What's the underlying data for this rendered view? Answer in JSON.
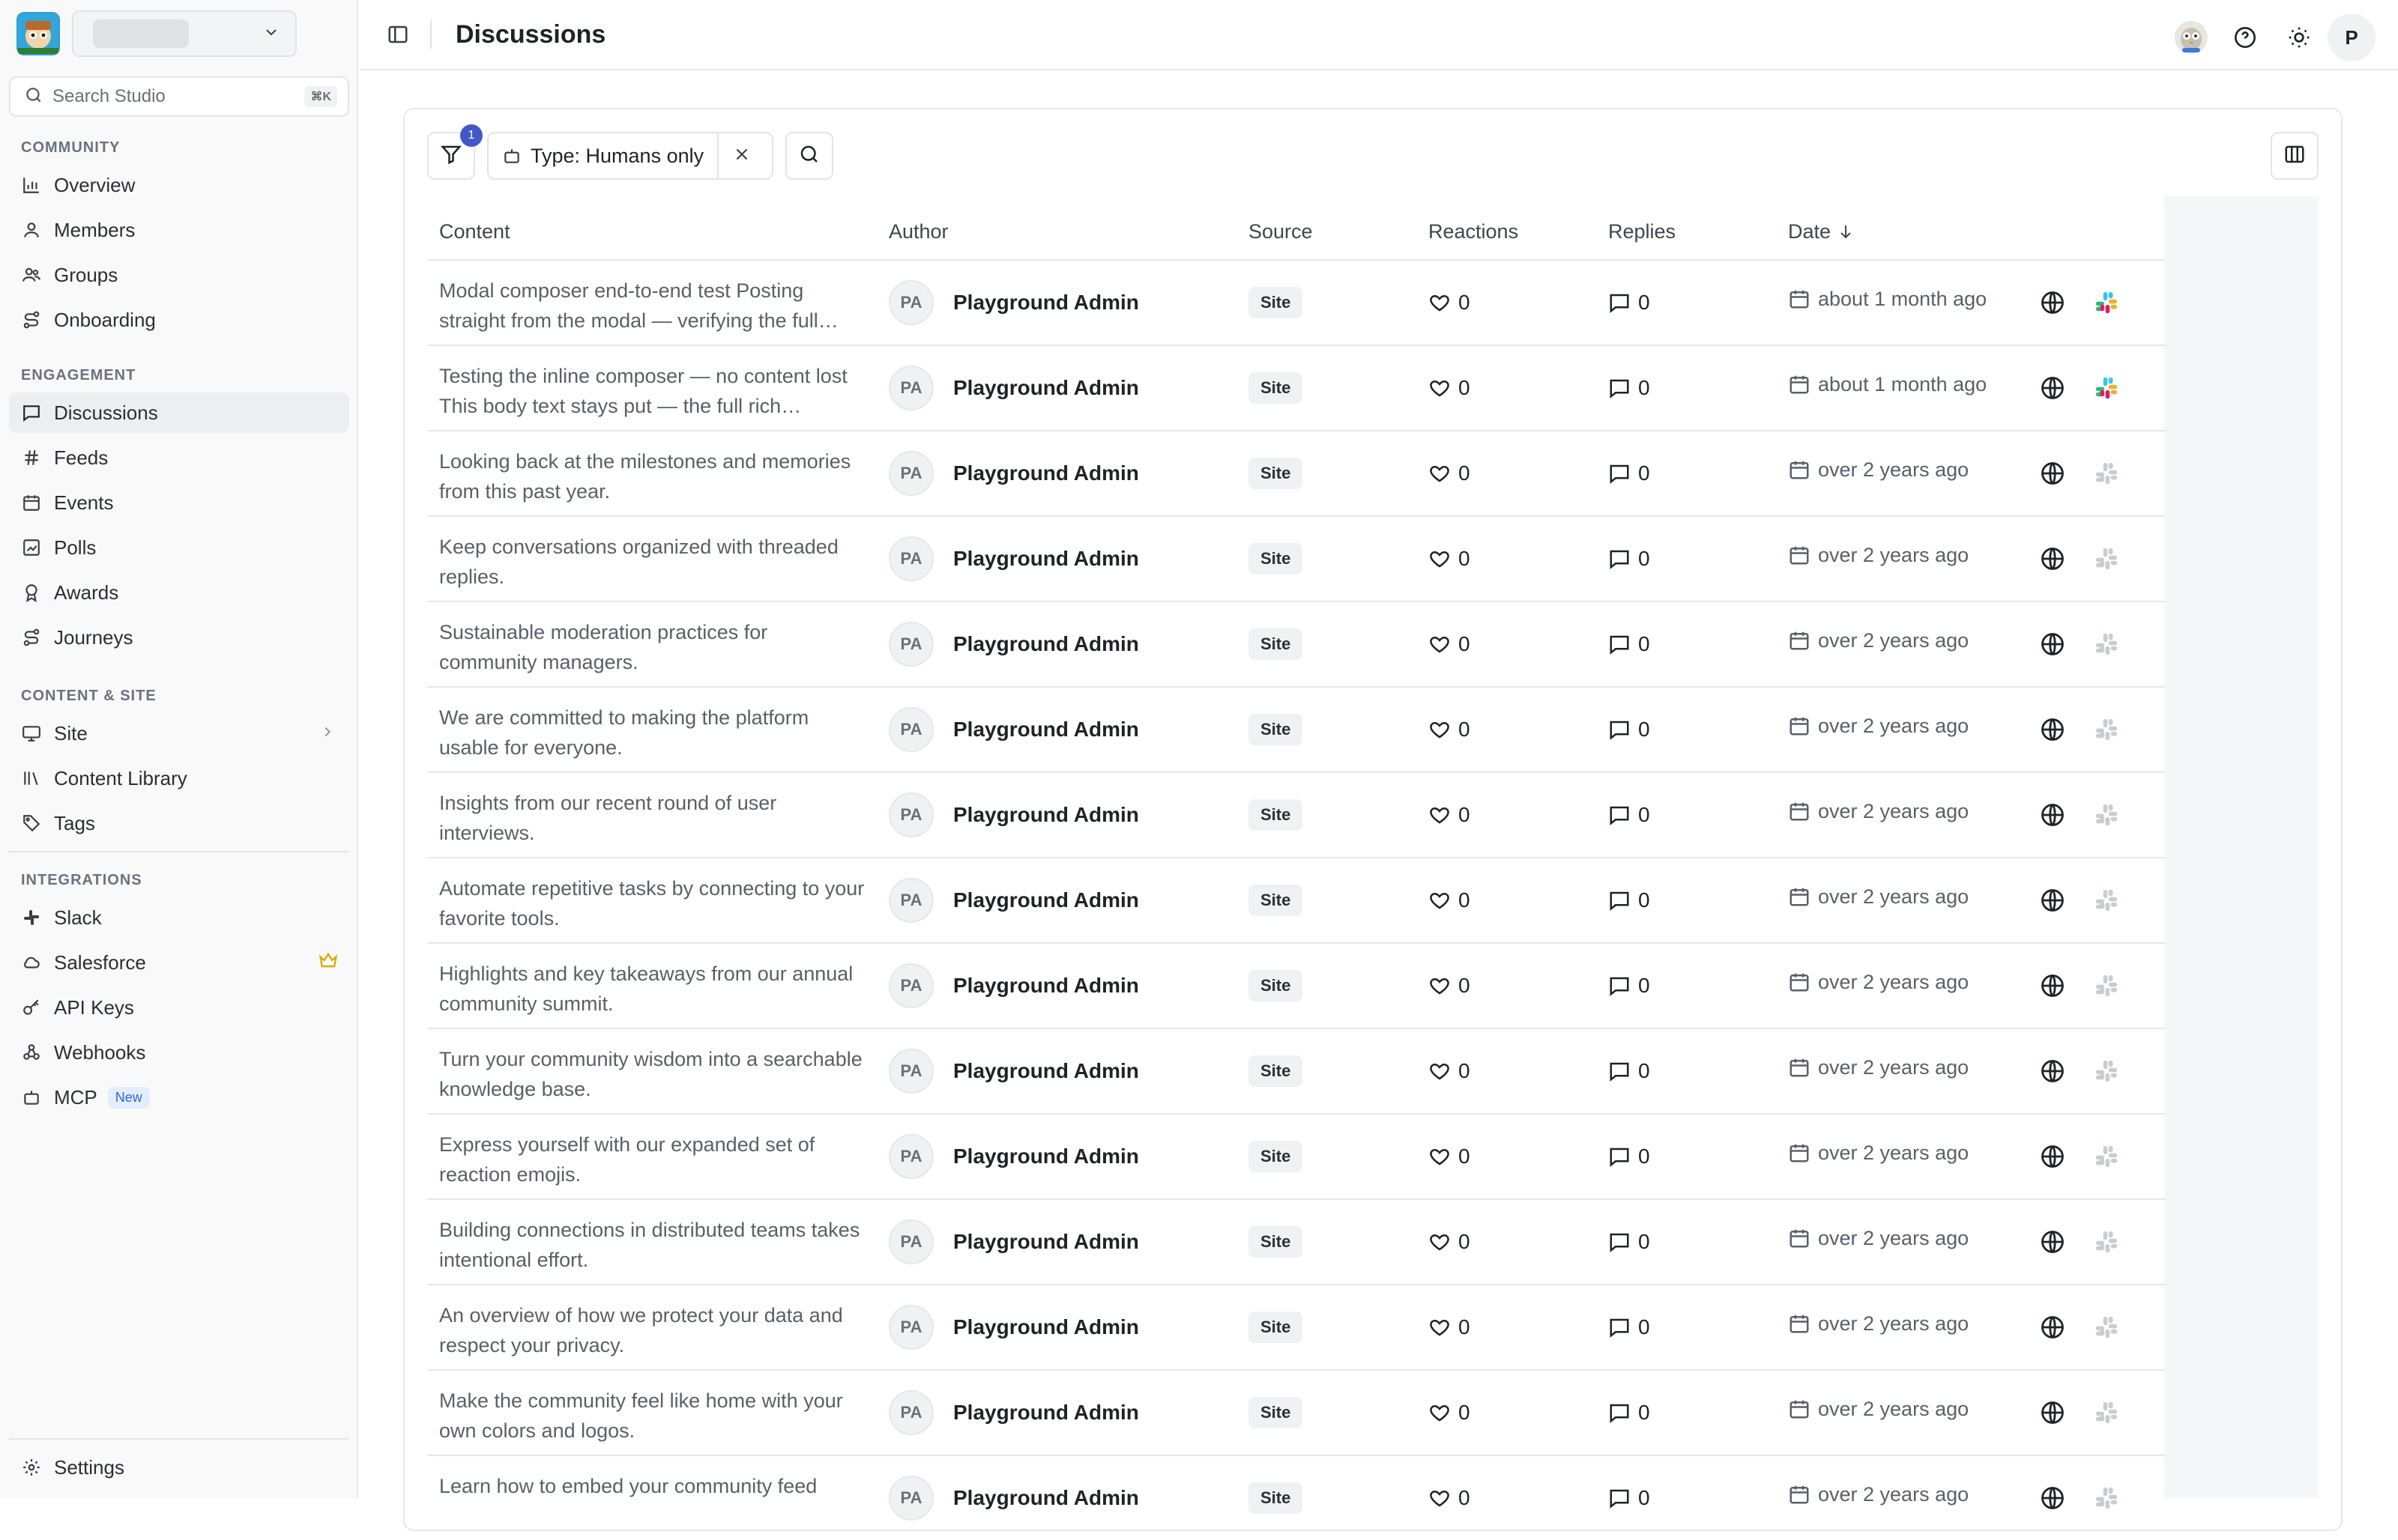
{
  "sidebar": {
    "search_placeholder": "Search Studio",
    "search_shortcut": "⌘K",
    "sections": {
      "community": "COMMUNITY",
      "engagement": "ENGAGEMENT",
      "content": "CONTENT & SITE",
      "integrations": "INTEGRATIONS"
    },
    "items": {
      "overview": "Overview",
      "members": "Members",
      "groups": "Groups",
      "onboarding": "Onboarding",
      "discussions": "Discussions",
      "feeds": "Feeds",
      "events": "Events",
      "polls": "Polls",
      "awards": "Awards",
      "journeys": "Journeys",
      "site": "Site",
      "content_library": "Content Library",
      "tags": "Tags",
      "slack": "Slack",
      "salesforce": "Salesforce",
      "api_keys": "API Keys",
      "webhooks": "Webhooks",
      "mcp": "MCP",
      "mcp_badge": "New",
      "settings": "Settings"
    }
  },
  "header": {
    "title": "Discussions",
    "avatar_initial": "P"
  },
  "toolbar": {
    "filter_count": "1",
    "filter_chip": "Type: Humans only"
  },
  "table": {
    "columns": [
      "Content",
      "Author",
      "Source",
      "Reactions",
      "Replies",
      "Date"
    ],
    "rows": [
      {
        "content": "Modal composer end-to-end test Posting straight from the modal — verifying the full…",
        "initials": "PA",
        "author": "Playground Admin",
        "source": "Site",
        "reactions": "0",
        "replies": "0",
        "date": "about 1 month ago",
        "slack": true
      },
      {
        "content": "Testing the inline composer — no content lost This body text stays put — the full rich…",
        "initials": "PA",
        "author": "Playground Admin",
        "source": "Site",
        "reactions": "0",
        "replies": "0",
        "date": "about 1 month ago",
        "slack": true
      },
      {
        "content": "Looking back at the milestones and memories from this past year.",
        "initials": "PA",
        "author": "Playground Admin",
        "source": "Site",
        "reactions": "0",
        "replies": "0",
        "date": "over 2 years ago",
        "slack": false
      },
      {
        "content": "Keep conversations organized with threaded replies.",
        "initials": "PA",
        "author": "Playground Admin",
        "source": "Site",
        "reactions": "0",
        "replies": "0",
        "date": "over 2 years ago",
        "slack": false
      },
      {
        "content": "Sustainable moderation practices for community managers.",
        "initials": "PA",
        "author": "Playground Admin",
        "source": "Site",
        "reactions": "0",
        "replies": "0",
        "date": "over 2 years ago",
        "slack": false
      },
      {
        "content": "We are committed to making the platform usable for everyone.",
        "initials": "PA",
        "author": "Playground Admin",
        "source": "Site",
        "reactions": "0",
        "replies": "0",
        "date": "over 2 years ago",
        "slack": false
      },
      {
        "content": "Insights from our recent round of user interviews.",
        "initials": "PA",
        "author": "Playground Admin",
        "source": "Site",
        "reactions": "0",
        "replies": "0",
        "date": "over 2 years ago",
        "slack": false
      },
      {
        "content": "Automate repetitive tasks by connecting to your favorite tools.",
        "initials": "PA",
        "author": "Playground Admin",
        "source": "Site",
        "reactions": "0",
        "replies": "0",
        "date": "over 2 years ago",
        "slack": false
      },
      {
        "content": "Highlights and key takeaways from our annual community summit.",
        "initials": "PA",
        "author": "Playground Admin",
        "source": "Site",
        "reactions": "0",
        "replies": "0",
        "date": "over 2 years ago",
        "slack": false
      },
      {
        "content": "Turn your community wisdom into a searchable knowledge base.",
        "initials": "PA",
        "author": "Playground Admin",
        "source": "Site",
        "reactions": "0",
        "replies": "0",
        "date": "over 2 years ago",
        "slack": false
      },
      {
        "content": "Express yourself with our expanded set of reaction emojis.",
        "initials": "PA",
        "author": "Playground Admin",
        "source": "Site",
        "reactions": "0",
        "replies": "0",
        "date": "over 2 years ago",
        "slack": false
      },
      {
        "content": "Building connections in distributed teams takes intentional effort.",
        "initials": "PA",
        "author": "Playground Admin",
        "source": "Site",
        "reactions": "0",
        "replies": "0",
        "date": "over 2 years ago",
        "slack": false
      },
      {
        "content": "An overview of how we protect your data and respect your privacy.",
        "initials": "PA",
        "author": "Playground Admin",
        "source": "Site",
        "reactions": "0",
        "replies": "0",
        "date": "over 2 years ago",
        "slack": false
      },
      {
        "content": "Make the community feel like home with your own colors and logos.",
        "initials": "PA",
        "author": "Playground Admin",
        "source": "Site",
        "reactions": "0",
        "replies": "0",
        "date": "over 2 years ago",
        "slack": false
      },
      {
        "content": "Learn how to embed your community feed",
        "initials": "PA",
        "author": "Playground Admin",
        "source": "Site",
        "reactions": "0",
        "replies": "0",
        "date": "over 2 years ago",
        "slack": false
      }
    ]
  },
  "colors": {
    "accent": "#4457c9",
    "new_badge": "#2c6ad6",
    "crown": "#e0a800"
  }
}
